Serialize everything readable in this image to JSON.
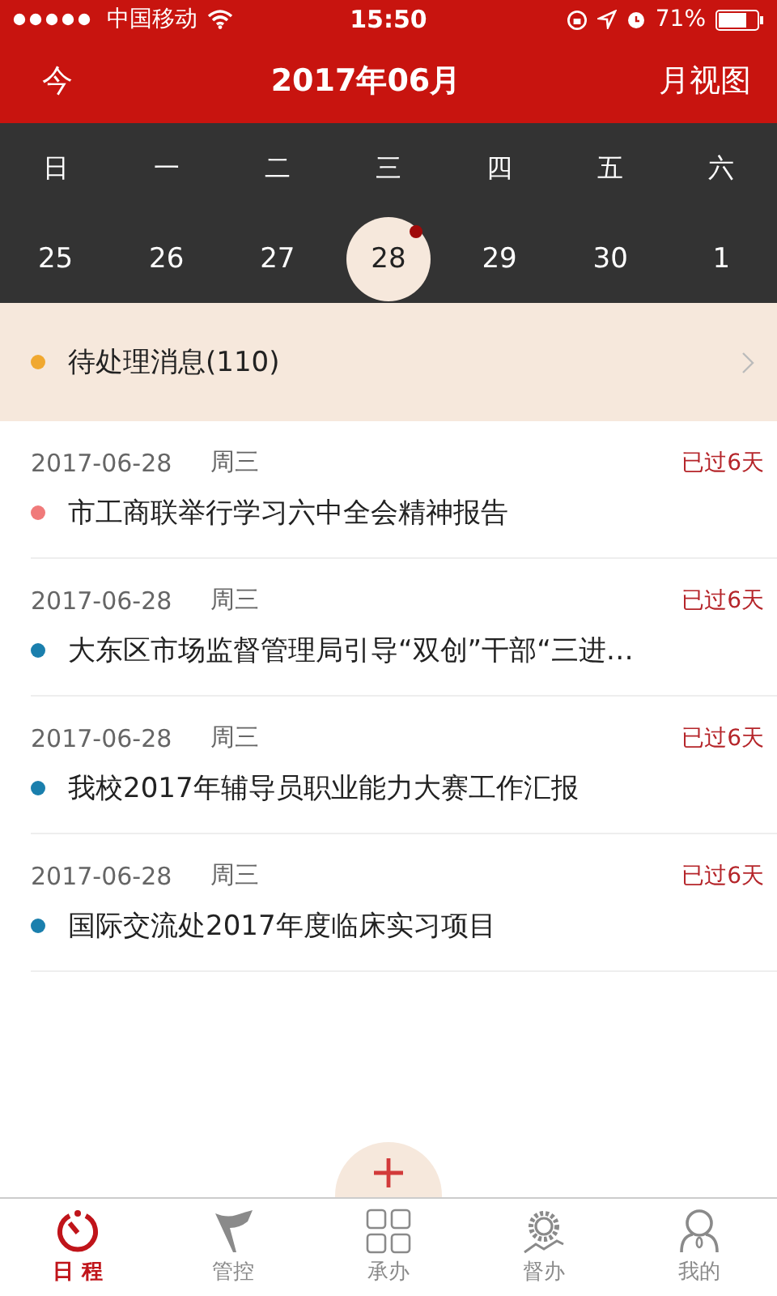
{
  "status_bar": {
    "carrier": "中国移动",
    "time": "15:50",
    "battery": "71%"
  },
  "header": {
    "left": "今",
    "title": "2017年06月",
    "right": "月视图"
  },
  "calendar": {
    "weekdays": [
      "日",
      "一",
      "二",
      "三",
      "四",
      "五",
      "六"
    ],
    "days": [
      {
        "label": "25",
        "selected": false,
        "has_event": false
      },
      {
        "label": "26",
        "selected": false,
        "has_event": false
      },
      {
        "label": "27",
        "selected": false,
        "has_event": false
      },
      {
        "label": "28",
        "selected": true,
        "has_event": true
      },
      {
        "label": "29",
        "selected": false,
        "has_event": false
      },
      {
        "label": "30",
        "selected": false,
        "has_event": false
      },
      {
        "label": "1",
        "selected": false,
        "has_event": false
      }
    ]
  },
  "pending": {
    "label": "待处理消息(110)",
    "color": "#f0a830"
  },
  "events": [
    {
      "date": "2017-06-28",
      "weekday": "周三",
      "overdue": "已过6天",
      "title": "市工商联举行学习六中全会精神报告",
      "color": "#f07a7a"
    },
    {
      "date": "2017-06-28",
      "weekday": "周三",
      "overdue": "已过6天",
      "title": "大东区市场监督管理局引导“双创”干部“三进…",
      "color": "#1a7fad"
    },
    {
      "date": "2017-06-28",
      "weekday": "周三",
      "overdue": "已过6天",
      "title": "我校2017年辅导员职业能力大赛工作汇报",
      "color": "#1a7fad"
    },
    {
      "date": "2017-06-28",
      "weekday": "周三",
      "overdue": "已过6天",
      "title": "国际交流处2017年度临床实习项目",
      "color": "#1a7fad"
    }
  ],
  "tab_bar": [
    {
      "kind": "timer",
      "label": "日 程",
      "selected": true
    },
    {
      "kind": "flag",
      "label": "管控",
      "selected": false
    },
    {
      "kind": "grid",
      "label": "承办",
      "selected": false
    },
    {
      "kind": "gear",
      "label": "督办",
      "selected": false
    },
    {
      "kind": "person",
      "label": "我的",
      "selected": false
    }
  ]
}
